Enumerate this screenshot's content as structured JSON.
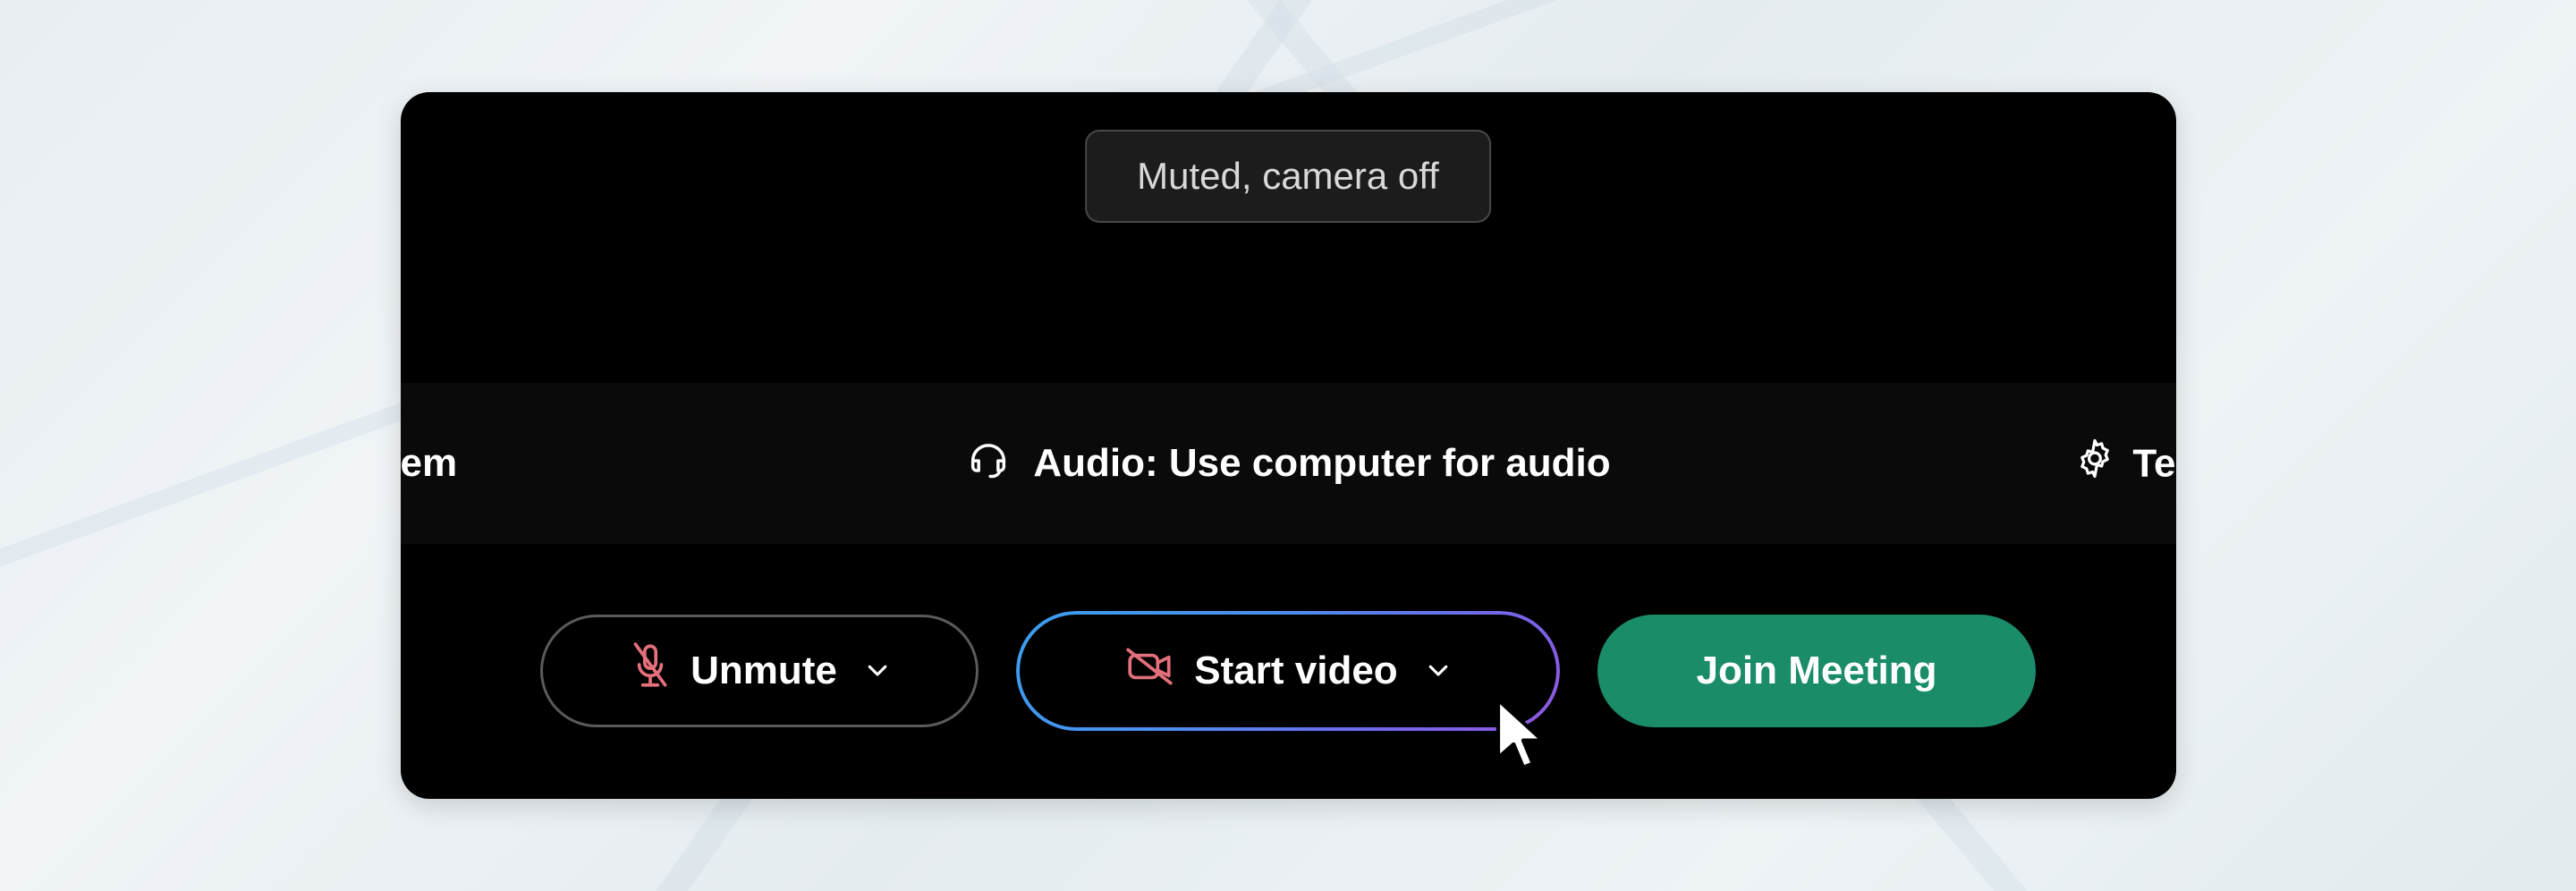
{
  "status_text": "Muted, camera off",
  "left_fragment": "em",
  "audio_option_label": "Audio: Use computer for audio",
  "right_fragment": "Te",
  "buttons": {
    "unmute_label": "Unmute",
    "start_video_label": "Start video",
    "join_label": "Join Meeting"
  },
  "colors": {
    "panel_bg": "#000000",
    "join_green": "#1a8c6a",
    "mic_red": "#e3707a",
    "camera_red": "#e3707a"
  }
}
